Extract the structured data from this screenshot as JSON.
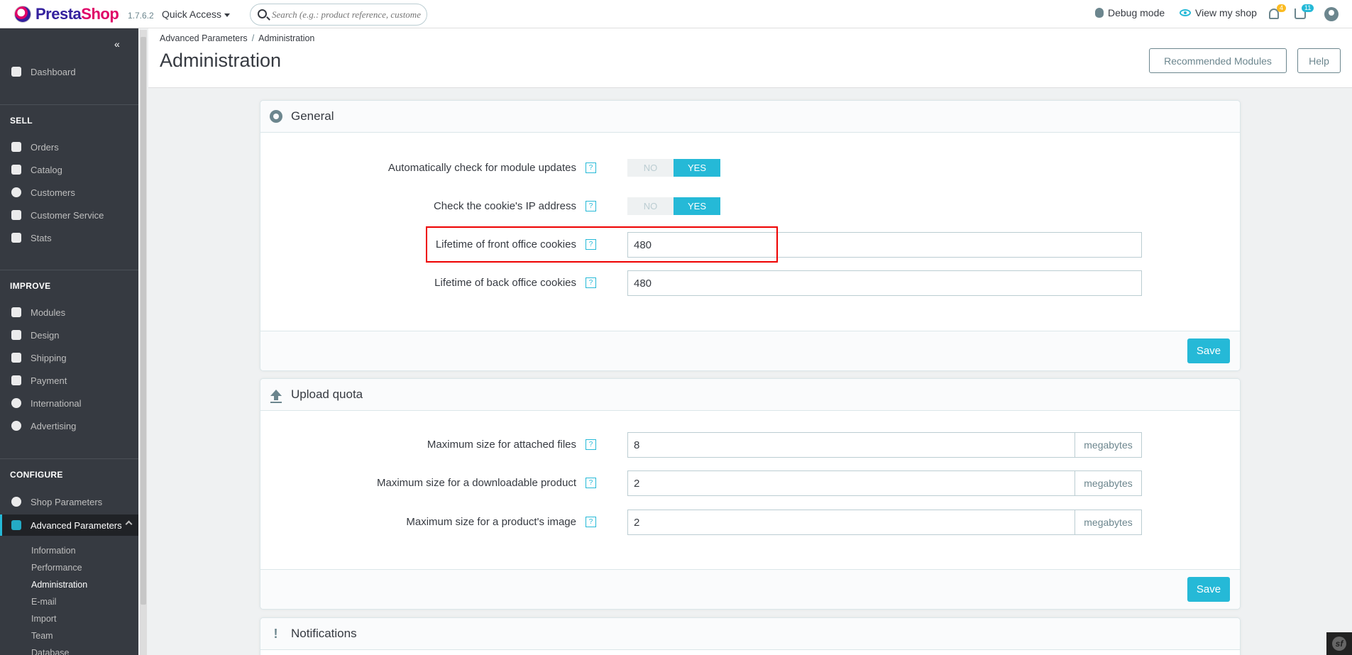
{
  "header": {
    "logo_text_a": "Presta",
    "logo_text_b": "Shop",
    "version": "1.7.6.2",
    "quick_access": "Quick Access",
    "search_placeholder": "Search (e.g.: product reference, custome",
    "debug_mode": "Debug mode",
    "view_shop": "View my shop",
    "notif_count": "4",
    "cart_count": "11"
  },
  "sidebar": {
    "dashboard": "Dashboard",
    "sell": "SELL",
    "sell_items": [
      "Orders",
      "Catalog",
      "Customers",
      "Customer Service",
      "Stats"
    ],
    "improve": "IMPROVE",
    "improve_items": [
      "Modules",
      "Design",
      "Shipping",
      "Payment",
      "International",
      "Advertising"
    ],
    "configure": "CONFIGURE",
    "configure_items": [
      "Shop Parameters",
      "Advanced Parameters"
    ],
    "sub_items": [
      "Information",
      "Performance",
      "Administration",
      "E-mail",
      "Import",
      "Team",
      "Database"
    ]
  },
  "page": {
    "breadcrumb": [
      "Advanced Parameters",
      "Administration"
    ],
    "title": "Administration",
    "btn_recommended": "Recommended Modules",
    "btn_help": "Help"
  },
  "general": {
    "title": "General",
    "rows": [
      {
        "label": "Automatically check for module updates",
        "no": "NO",
        "yes": "YES"
      },
      {
        "label": "Check the cookie's IP address",
        "no": "NO",
        "yes": "YES"
      },
      {
        "label": "Lifetime of front office cookies",
        "value": "480"
      },
      {
        "label": "Lifetime of back office cookies",
        "value": "480"
      }
    ],
    "save": "Save"
  },
  "upload": {
    "title": "Upload quota",
    "rows": [
      {
        "label": "Maximum size for attached files",
        "value": "8",
        "unit": "megabytes"
      },
      {
        "label": "Maximum size for a downloadable product",
        "value": "2",
        "unit": "megabytes"
      },
      {
        "label": "Maximum size for a product's image",
        "value": "2",
        "unit": "megabytes"
      }
    ],
    "save": "Save"
  },
  "notifications": {
    "title": "Notifications"
  },
  "help_glyph": "?",
  "colors": {
    "accent": "#25b9d7",
    "sidebar_bg": "#363a41",
    "highlight": "#ee0000"
  }
}
